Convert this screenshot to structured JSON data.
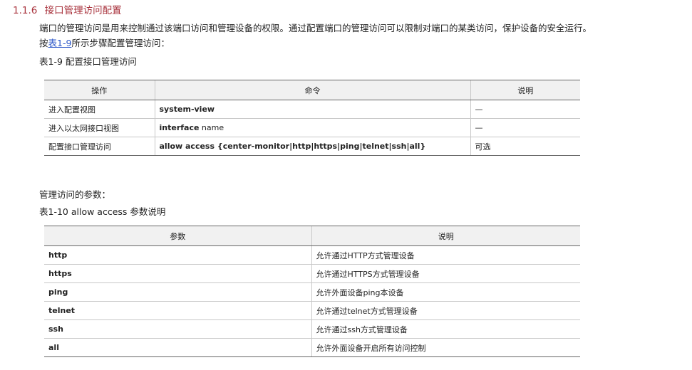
{
  "section": {
    "number": "1.1.6",
    "title": "接口管理访问配置"
  },
  "intro": "端口的管理访问是用来控制通过该端口访问和管理设备的权限。通过配置端口的管理访问可以限制对端口的某类访问，保护设备的安全运行。",
  "steps_line": {
    "prefix": "按",
    "link": "表1-9",
    "suffix": "所示步骤配置管理访问："
  },
  "table1": {
    "caption": "表1-9 配置接口管理访问",
    "headers": [
      "操作",
      "命令",
      "说明"
    ],
    "rows": [
      {
        "op": "进入配置视图",
        "cmd_bold": "system-view",
        "cmd_rest": "",
        "note": "—"
      },
      {
        "op": "进入以太网接口视图",
        "cmd_bold": "interface",
        "cmd_rest": " name",
        "note": "—"
      },
      {
        "op": "配置接口管理访问",
        "cmd_bold": "allow access {center-monitor|http|https|ping|telnet|ssh|all}",
        "cmd_rest": "",
        "note": "可选"
      }
    ]
  },
  "params_intro": "管理访问的参数：",
  "table2": {
    "caption": "表1-10 allow access 参数说明",
    "headers": [
      "参数",
      "说明"
    ],
    "rows": [
      {
        "param": "http",
        "desc": "允许通过HTTP方式管理设备"
      },
      {
        "param": "https",
        "desc": "允许通过HTTPS方式管理设备"
      },
      {
        "param": "ping",
        "desc": "允许外面设备ping本设备"
      },
      {
        "param": "telnet",
        "desc": "允许通过telnet方式管理设备"
      },
      {
        "param": "ssh",
        "desc": "允许通过ssh方式管理设备"
      },
      {
        "param": "all",
        "desc": "允许外面设备开启所有访问控制"
      }
    ]
  }
}
